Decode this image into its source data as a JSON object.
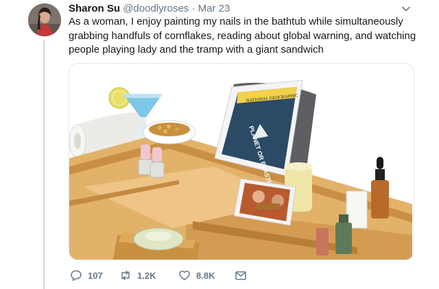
{
  "tweet": {
    "display_name": "Sharon Su",
    "handle": "@doodlyroses",
    "separator": "·",
    "time": "Mar 23",
    "text": "As a woman, I enjoy painting my nails in the bathtub while simultaneously grabbing handfuls of cornflakes, reading about global warning, and watching people playing lady and the tramp with a giant sandwich"
  },
  "media": {
    "magazine_title": "NATIONAL GEOGRAPHIC",
    "magazine_cover_text": "PLANET OR PLASTIC?"
  },
  "actions": {
    "reply_count": "107",
    "retweet_count": "1.2K",
    "like_count": "8.8K"
  },
  "colors": {
    "text": "#14171a",
    "secondary": "#657786",
    "border": "#e1e8ed",
    "thread_line": "#ccd6dd"
  }
}
